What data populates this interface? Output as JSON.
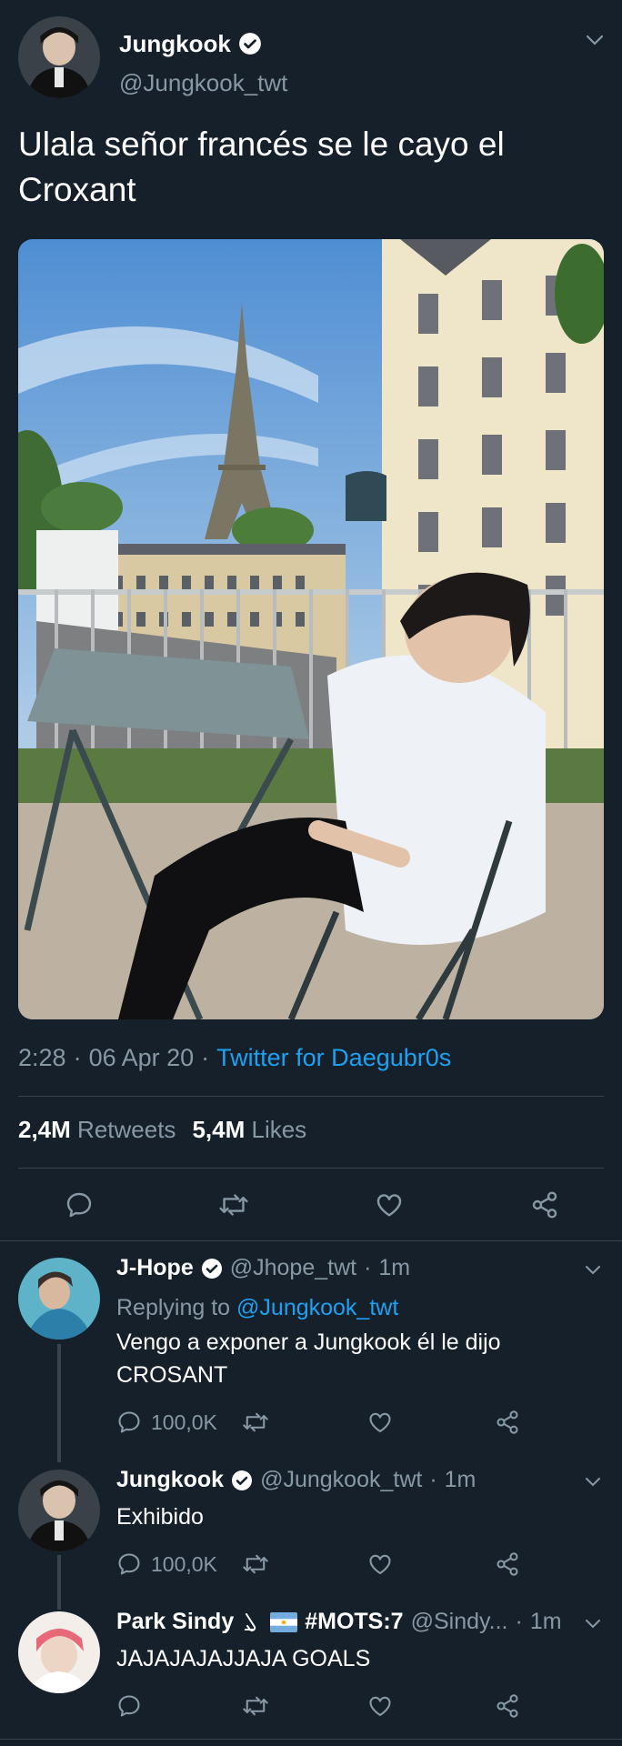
{
  "main_tweet": {
    "author_name": "Jungkook",
    "author_handle": "@Jungkook_twt",
    "text_line1": "Ulala señor francés se le cayo el",
    "text_line2": "Croxant",
    "time": "2:28",
    "date": "06 Apr 20",
    "source": "Twitter for Daegubr0s",
    "separator": "·",
    "retweets_count": "2,4M",
    "retweets_label": "Retweets",
    "likes_count": "5,4M",
    "likes_label": "Likes",
    "photo_description": "Eiffel Tower balcony photo",
    "verified_icon": "verified-badge-icon"
  },
  "replies": [
    {
      "name": "J-Hope",
      "handle": "@Jhope_twt",
      "time": "1m",
      "replying_prefix": "Replying to",
      "replying_to": "@Jungkook_twt",
      "text_line1": "Vengo a exponer a Jungkook él le dijo",
      "text_line2": "CROSANT",
      "reply_count": "100,0K"
    },
    {
      "name": "Jungkook",
      "handle": "@Jungkook_twt",
      "time": "1m",
      "text_line1": "Exhibido",
      "reply_count": "100,0K"
    },
    {
      "name": "Park Sindy",
      "name_suffix": "#MOTS:7",
      "handle": "@Sindy...",
      "time": "1m",
      "text_line1": "JAJAJAJAJJAJA GOALS"
    }
  ],
  "colors": {
    "background": "#15202b",
    "text": "#ffffff",
    "muted": "#8899a6",
    "link": "#1da1f2",
    "divider": "#38444d"
  }
}
